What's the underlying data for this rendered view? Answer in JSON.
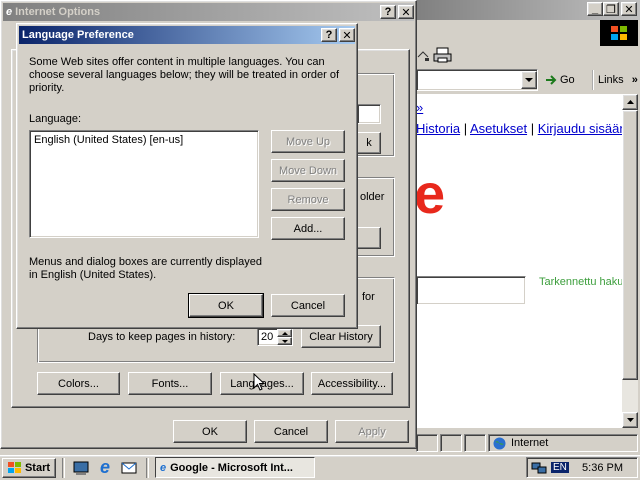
{
  "ie_window": {
    "menu_icons": [
      "printer-icon",
      "mail-icon"
    ],
    "address_go": "Go",
    "links_label": "Links",
    "page_links": [
      "Historia",
      "Asetukset",
      "Kirjaudu sisään"
    ],
    "more_link": "»",
    "advanced_search": "Tarkennettu haku",
    "google_logo_fragment": "e",
    "statusbar_zone": "Internet",
    "left_fragment": "H"
  },
  "internet_options": {
    "title": "Internet Options",
    "history_label": "Days to keep pages in history:",
    "history_days": "20",
    "clear_history": "Clear History",
    "partial_labels": [
      "older",
      "for"
    ],
    "partial_button": "k",
    "buttons": {
      "colors": "Colors...",
      "fonts": "Fonts...",
      "languages": "Languages...",
      "accessibility": "Accessibility..."
    },
    "ok": "OK",
    "cancel": "Cancel",
    "apply": "Apply"
  },
  "language_dialog": {
    "title": "Language Preference",
    "description": "Some Web sites offer content in multiple languages. You can choose several languages below; they will be treated in order of priority.",
    "language_label": "Language:",
    "languages": [
      "English (United States) [en-us]"
    ],
    "move_up": "Move Up",
    "move_down": "Move Down",
    "remove": "Remove",
    "add": "Add...",
    "menus_note": "Menus and dialog boxes are currently displayed in English (United States).",
    "ok": "OK",
    "cancel": "Cancel"
  },
  "taskbar": {
    "start": "Start",
    "task_label": "Google - Microsoft Int...",
    "lang_indicator": "EN",
    "clock": "5:36 PM"
  },
  "colors": {
    "title_active": "#0a246a",
    "title_active_end": "#a6caf0",
    "title_inactive": "#808080",
    "title_inactive_end": "#c0c0c0",
    "face": "#d4d0c8",
    "desktop": "#3a6ea5",
    "google_red": "#e8281c",
    "advanced_green": "#3c9e3c"
  }
}
